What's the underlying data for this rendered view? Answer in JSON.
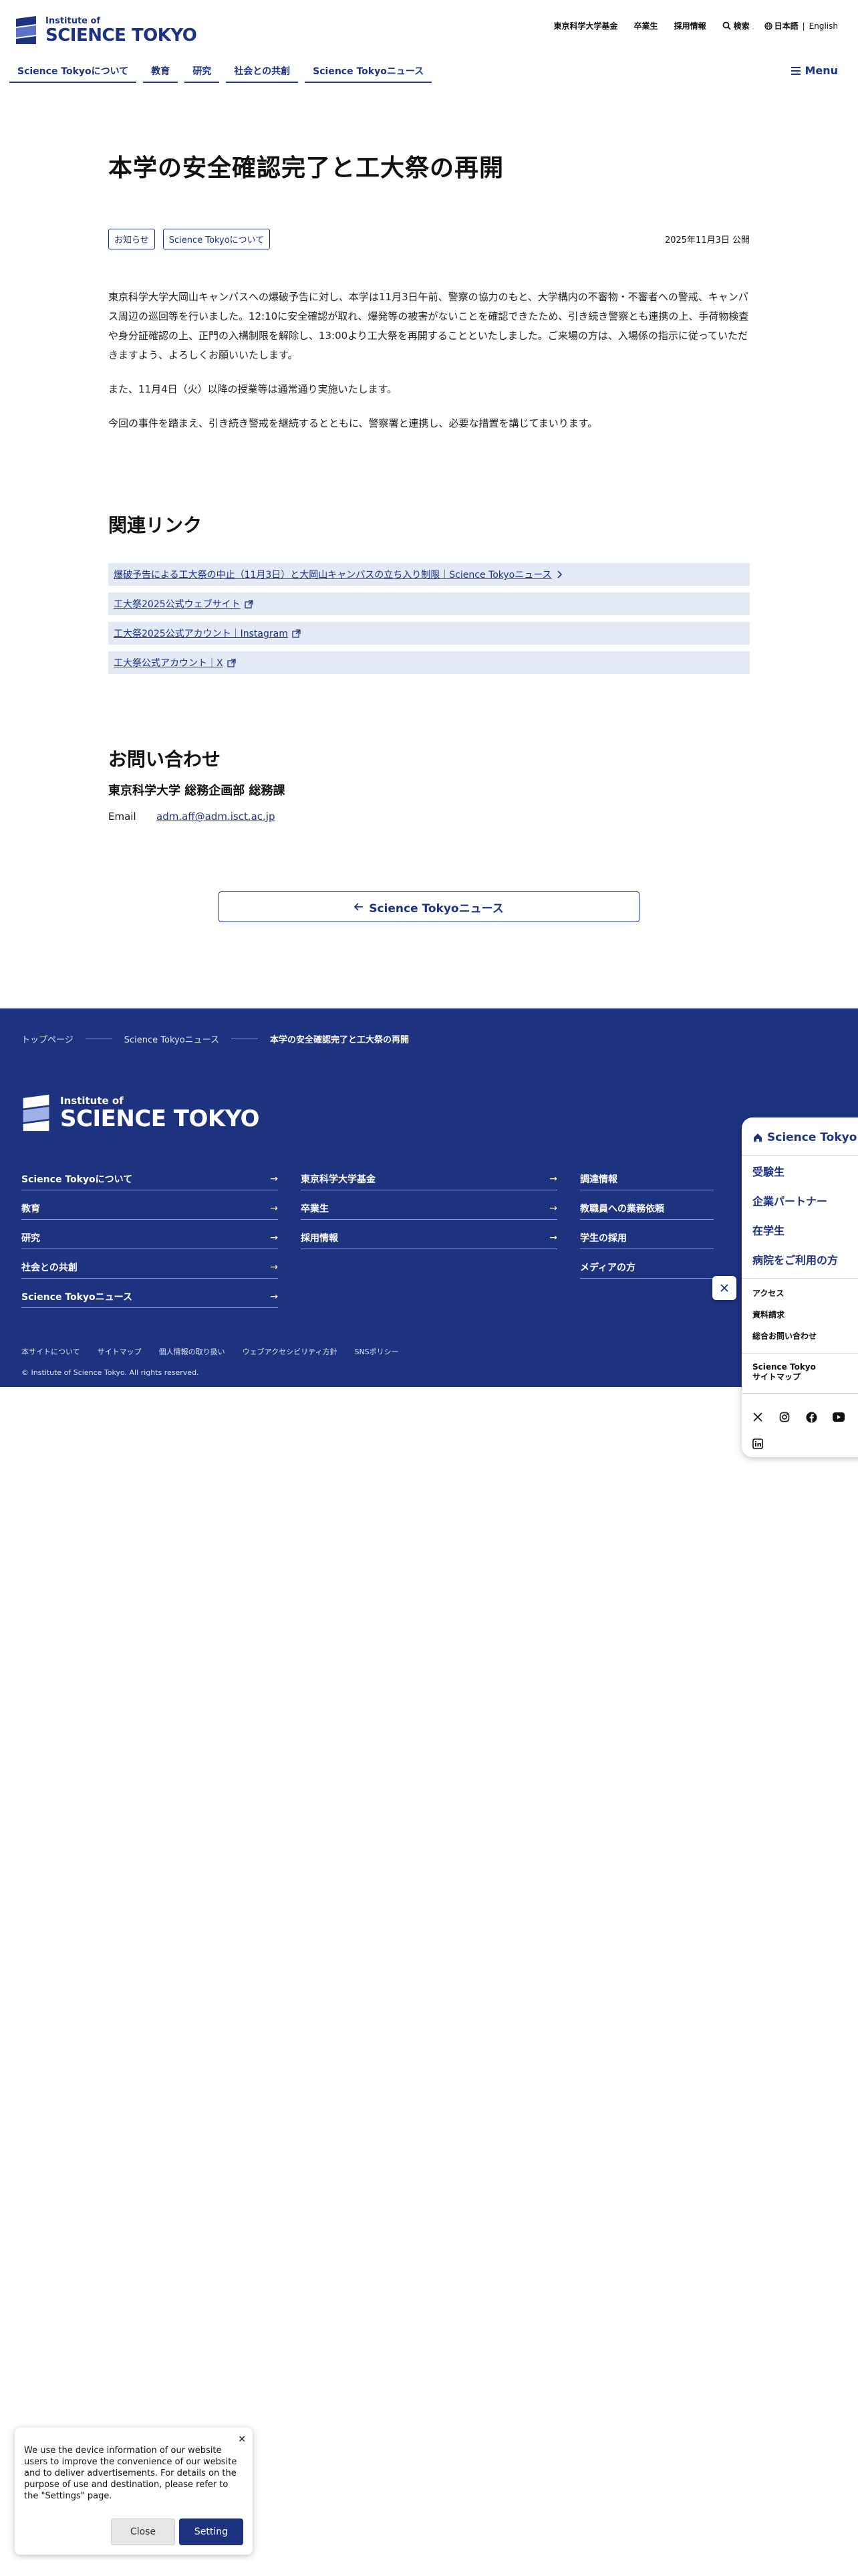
{
  "header": {
    "logo_small": "Institute of",
    "logo_big": "SCIENCE TOKYO",
    "util_links": [
      "東京科学大学基金",
      "卒業生",
      "採用情報"
    ],
    "search_label": "検索",
    "lang_current": "日本語",
    "lang_sep": "|",
    "lang_other": "English",
    "nav": [
      "Science Tokyoについて",
      "教育",
      "研究",
      "社会との共創",
      "Science Tokyoニュース"
    ],
    "menu_label": "Menu"
  },
  "article": {
    "title": "本学の安全確認完了と工大祭の再開",
    "tags": [
      "お知らせ",
      "Science Tokyoについて"
    ],
    "date": "2025年11月3日 公開",
    "paragraphs": [
      "東京科学大学大岡山キャンパスへの爆破予告に対し、本学は11月3日午前、警察の協力のもと、大学構内の不審物・不審者への警戒、キャンパス周辺の巡回等を行いました。12:10に安全確認が取れ、爆発等の被害がないことを確認できたため、引き続き警察とも連携の上、手荷物検査や身分証確認の上、正門の入構制限を解除し、13:00より工大祭を再開することといたしました。ご来場の方は、入場係の指示に従っていただきますよう、よろしくお願いいたします。",
      "また、11月4日（火）以降の授業等は通常通り実施いたします。",
      "今回の事件を踏まえ、引き続き警戒を継続するとともに、警察署と連携し、必要な措置を講じてまいります。"
    ]
  },
  "related": {
    "title": "関連リンク",
    "links": [
      {
        "label": "爆破予告による工大祭の中止（11月3日）と大岡山キャンパスの立ち入り制限｜Science Tokyoニュース",
        "icon": "chevron-right-icon"
      },
      {
        "label": "工大祭2025公式ウェブサイト",
        "icon": "external-link-icon"
      },
      {
        "label": "工大祭2025公式アカウント｜Instagram",
        "icon": "external-link-icon"
      },
      {
        "label": "工大祭公式アカウント｜X",
        "icon": "external-link-icon"
      }
    ]
  },
  "contact": {
    "title": "お問い合わせ",
    "org": "東京科学大学 総務企画部 総務課",
    "email_label": "Email",
    "email": "adm.aff@adm.isct.ac.jp"
  },
  "news_button": "Science Tokyoニュース",
  "footer": {
    "breadcrumb": [
      "トップページ",
      "Science Tokyoニュース",
      "本学の安全確認完了と工大祭の再開"
    ],
    "logo_small": "Institute of",
    "logo_big": "SCIENCE TOKYO",
    "col1": [
      "Science Tokyoについて",
      "教育",
      "研究",
      "社会との共創",
      "Science Tokyoニュース"
    ],
    "col2": [
      "東京科学大学基金",
      "卒業生",
      "採用情報"
    ],
    "col3": [
      "調達情報",
      "教職員への業務依頼",
      "学生の採用",
      "メディアの方"
    ],
    "sub_links": [
      "本サイトについて",
      "サイトマップ",
      "個人情報の取り扱い",
      "ウェブアクセシビリティ方針",
      "SNSポリシー"
    ],
    "copyright": "© Institute of Science Tokyo. All rights reserved."
  },
  "float_panel": {
    "top_label": "Science Tokyo",
    "items": [
      "受験生",
      "企業パートナー",
      "在学生",
      "病院をご利用の方"
    ],
    "small_items": [
      "アクセス",
      "資料請求",
      "総合お問い合わせ"
    ],
    "sitemap_line1": "Science Tokyo",
    "sitemap_line2": "サイトマップ",
    "social": [
      "x-icon",
      "instagram-icon",
      "facebook-icon",
      "youtube-icon",
      "linkedin-icon"
    ]
  },
  "cookie": {
    "text": "We use the device information of our website users to improve the convenience of our website and to deliver advertisements. For details on the purpose of use and destination, please refer to the \"Settings\" page.",
    "close_label": "Close",
    "setting_label": "Setting"
  },
  "colors": {
    "brand": "#1e3380",
    "link_bg": "#e4eaf5"
  }
}
